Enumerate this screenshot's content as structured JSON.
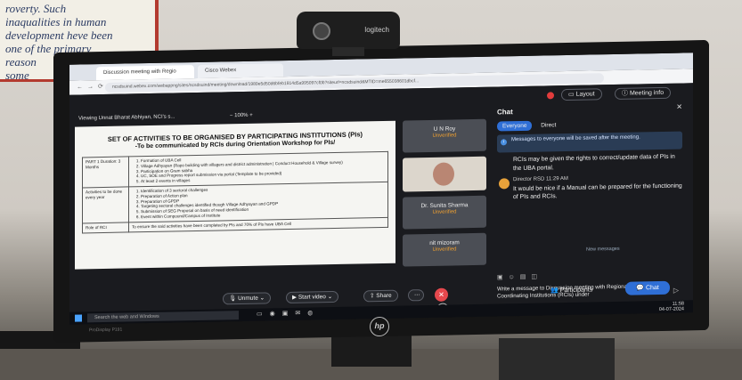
{
  "poster": {
    "lines": [
      "roverty. Such",
      "inaqualities in human",
      "development heve been",
      "one of the primary",
      "reason",
      "some"
    ]
  },
  "webcam": {
    "brand": "logitech"
  },
  "browser": {
    "tabs": [
      "Discussion meeting with Regio",
      "Cisco Webex"
    ],
    "url": "ncsdsuind.webex.com/webappng/sites/ncsdsuind/meeting/download/1989e5d50d6bfeb1814d5a995097cf0b?siteurl=ncsdsuind&MTID=me655038601dbcf..."
  },
  "webex": {
    "layout_label": "Layout",
    "meeting_info_label": "Meeting info",
    "share_header": "Viewing Unnat Bharat Abhiyan, NCI's s...",
    "zoom": "100%",
    "doc": {
      "title": "SET OF ACTIVITIES TO BE ORGANISED BY PARTICIPATING INSTITUTIONS (PIs)",
      "subtitle": "-To be communicated by RCIs during Orientation Workshop for PIs/",
      "rows": [
        {
          "label": "PART 1 Duration: 3 Months",
          "items": [
            "Formation of UBA Cell",
            "Village Adhyayan (Rapo building with villagers and district administration | Conduct Household & Village survey)",
            "Participation on Gram sabha",
            "UC, SOE and Progress report submission via portal (Template to be provided)",
            "At least 2 events in villages"
          ]
        },
        {
          "label": "Activities to be done every year",
          "items": [
            "Identification of 3 sectoral challenges",
            "Preparation of Action plan",
            "Preparation of GPDP",
            "Targeting sectoral challenges identified though Village Adhyayan and GPDP",
            "Submission of SEG Proposal on basis of need identification",
            "Event within Compound/Campus of Institute"
          ]
        },
        {
          "label": "Role of RCI",
          "items": [
            "To ensure the said activities have been completed by PIs and 70% of PIs have UBA Cell"
          ]
        }
      ]
    },
    "participants": [
      {
        "name": "U N Roy",
        "status": "Unverified"
      },
      {
        "name": "Dr. Sunita Sharma",
        "status": "Unverified"
      },
      {
        "name": "nit mizoram",
        "status": "Unverified"
      }
    ],
    "chat": {
      "title": "Chat",
      "tab_everyone": "Everyone",
      "tab_direct": "Direct",
      "notice": "Messages to everyone will be saved after the meeting.",
      "messages": [
        {
          "sender": "",
          "time": "",
          "text": "RCIs may be given the rights to correct/update data of PIs in the UBA portal."
        },
        {
          "sender": "Director RSD",
          "time": "11:29 AM",
          "text": "It would be nice if a Manual can be prepared for the functioning of PIs and RCIs."
        }
      ],
      "new_messages": "New messages",
      "placeholder": "Write a message to Discussion meeting with Regional Coordinating Institutions (RCIs) under"
    },
    "controls": {
      "unmute": "Unmute",
      "start_video": "Start video",
      "share": "Share",
      "participants": "Participants",
      "chat": "Chat"
    },
    "taskbar": {
      "search": "Search the web and Windows",
      "time": "11:58",
      "date": "04-07-2024"
    }
  },
  "monitor": {
    "brand": "hp",
    "model": "ProDisplay P191"
  }
}
